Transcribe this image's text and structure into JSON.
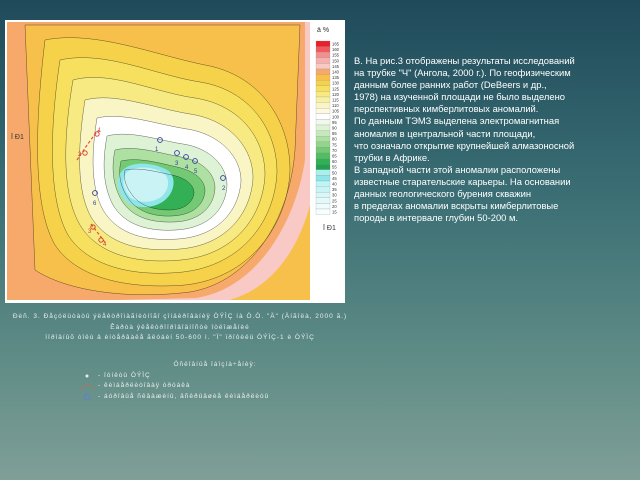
{
  "figure": {
    "scale_unit": "ä %",
    "scale_values": [
      "165",
      "160",
      "155",
      "150",
      "145",
      "140",
      "135",
      "130",
      "125",
      "120",
      "115",
      "110",
      "105",
      "100",
      "95",
      "90",
      "85",
      "80",
      "75",
      "70",
      "65",
      "60",
      "55",
      "50",
      "45",
      "40",
      "35",
      "30",
      "25",
      "20",
      "15"
    ],
    "scale_colors": [
      "#e8202a",
      "#ee5a5e",
      "#f38f8f",
      "#f6b0ad",
      "#f8c9c5",
      "#f6a96a",
      "#f7c04a",
      "#f6d24a",
      "#f6e05e",
      "#f7ea82",
      "#f8f0a4",
      "#faf5c4",
      "#fcf9de",
      "#ffffff",
      "#f2f9ec",
      "#def2d6",
      "#c6e9bb",
      "#aee0a2",
      "#92d58a",
      "#74ca74",
      "#52bd62",
      "#33b055",
      "#1fa24d",
      "#a9efee",
      "#8fe6ea",
      "#bff5f6",
      "#c9f3f5",
      "#d8f7f8",
      "#e4f9fa",
      "#eefcfc",
      "#f7fefe"
    ],
    "profile_label_left": "Ï Ð1",
    "profile_label_right": "Ï Ð1",
    "points_blue": [
      "1",
      "3",
      "4",
      "5",
      "2",
      "6"
    ],
    "points_red": [
      "1",
      "2",
      "3",
      "4"
    ]
  },
  "description": [
    "В. На рис.3 отображены результаты исследований",
    "на трубке \"Ч\" (Ангола, 2000 г.). По геофизическим",
    "данным более ранних работ (DeBeers и др.,",
    "1978) на изученной площади не было выделено",
    "перспективных  кимберлитовых аномалий.",
    "По данным ТЭМЗ выделена электромагнитная",
    "аномалия в центральной части площади,",
    "что означало открытие крупнейшей алмазоносной",
    " трубки в Африке.",
    " В западной части этой аномалии  расположены",
    "  известные старательские карьеры. На основании",
    "  данных геологического бурения скважин",
    "  в пределах  аномалии вскрыты кимберлитовые",
    "  породы в интервале глубин 50-200 м."
  ],
  "caption_lines": [
    "Ðèñ. 3. Ðåçóëüòàòû ýëåêòðîìàãíèòíîãî  çîíäèðîâàíèÿ ÒÝÌÇ  íà Ò.Ò. \"Ä\" (Àíãîëà, 2000 ã.)",
    "Êàðòà  ýëåêòðîïðîâîäíîñòè  îòëîæåíèé",
    "ïîðîäíûõ òîëù  â  èíòåðâàëå ãëóáèí 50-600 ì.  \"Ï\" ïðîôèëü  ÒÝÌÇ-1 è ÒÝÌÇ"
  ],
  "legend": {
    "heading": "Óñëîâíûå îáîçíà÷åíèÿ:",
    "items": [
      "- ïóíêòû ÒÝÌÇ",
      "- êèìáåðëèòîâàÿ òðóáêà",
      "- áóðîâûå ñêâàæèíû, âñêðûâøèå êèìáåðëèòû"
    ]
  }
}
